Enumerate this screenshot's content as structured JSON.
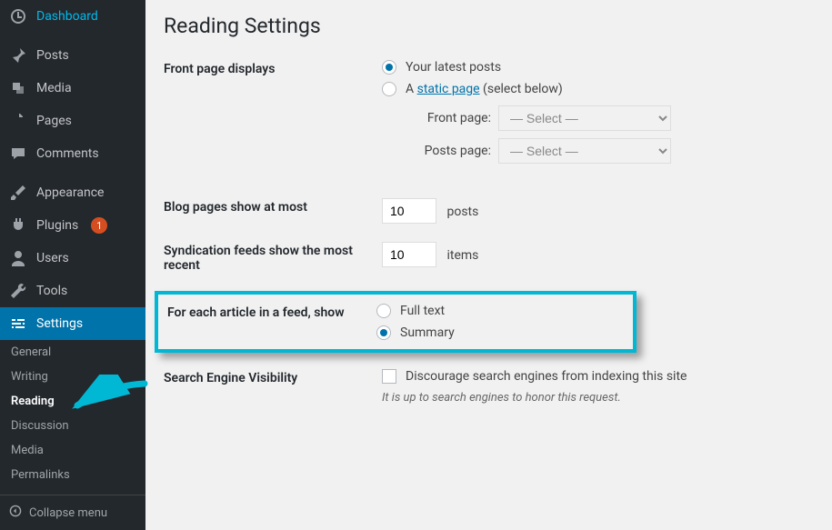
{
  "sidebar": {
    "dashboard": "Dashboard",
    "posts": "Posts",
    "media": "Media",
    "pages": "Pages",
    "comments": "Comments",
    "appearance": "Appearance",
    "plugins": "Plugins",
    "plugins_badge": "1",
    "users": "Users",
    "tools": "Tools",
    "settings": "Settings",
    "subs": {
      "general": "General",
      "writing": "Writing",
      "reading": "Reading",
      "discussion": "Discussion",
      "media": "Media",
      "permalinks": "Permalinks"
    },
    "collapse": "Collapse menu"
  },
  "page": {
    "title": "Reading Settings",
    "front_page_displays_label": "Front page displays",
    "radio_latest_posts": "Your latest posts",
    "radio_static_prefix": "A ",
    "radio_static_link": "static page",
    "radio_static_suffix": " (select below)",
    "front_page_label": "Front page:",
    "posts_page_label": "Posts page:",
    "select_placeholder": "— Select —",
    "blog_pages_label": "Blog pages show at most",
    "blog_pages_value": "10",
    "blog_pages_unit": "posts",
    "syndication_label": "Syndication feeds show the most recent",
    "syndication_value": "10",
    "syndication_unit": "items",
    "feed_show_label": "For each article in a feed, show",
    "feed_full_text": "Full text",
    "feed_summary": "Summary",
    "sev_label": "Search Engine Visibility",
    "sev_checkbox_label": "Discourage search engines from indexing this site",
    "sev_desc": "It is up to search engines to honor this request."
  }
}
